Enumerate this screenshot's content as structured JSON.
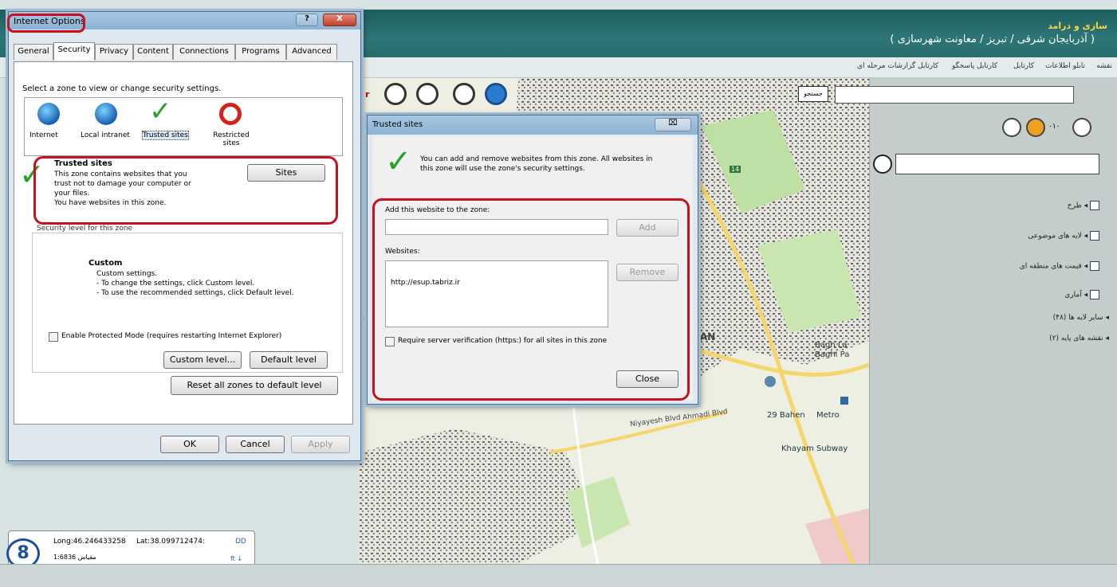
{
  "app": {
    "title": "سازی و درامد",
    "subtitle": "( آذربایجان شرقی / تبریز / معاونت شهرسازی )",
    "tabs": [
      "نقشه",
      "تابلو اطلاعات",
      "کارتابل",
      "کارتابل پاسخگو",
      "کارتابل گزارشات مرحله ای"
    ],
    "search_button": "جستجو",
    "map_labels": [
      "Bagh La",
      "Baghi Pa",
      "29 Bahen",
      "Metro",
      "Khayam Subway",
      "Niyayesh Blvd",
      "Ahmadi Blvd",
      "AN",
      "14"
    ],
    "coords": {
      "long": "Long:46.246433258",
      "lat": "Lat:38.099712474:",
      "dd": "DD",
      "scale": "مقیاس 1:6836",
      "scale_unit": "ft ↓"
    },
    "logo_text": "8"
  },
  "sidebar": {
    "layers": [
      "طرح",
      "لایه های موضوعی",
      "قیمت های منطقه ای",
      "آماری"
    ],
    "groups": [
      "سایر لایه ها (۴۸)",
      "نقشه های پایه (۲)"
    ],
    "zoom_value": "۰۱۰"
  },
  "internet_options": {
    "title": "Internet Options",
    "title_buttons": {
      "help": "?",
      "close": "X"
    },
    "tabs": [
      "General",
      "Security",
      "Privacy",
      "Content",
      "Connections",
      "Programs",
      "Advanced"
    ],
    "active_tab": "Security",
    "zone_prompt": "Select a zone to view or change security settings.",
    "zones": [
      "Internet",
      "Local intranet",
      "Trusted sites",
      "Restricted sites"
    ],
    "zone_title": "Trusted sites",
    "zone_desc_lines": [
      "This zone contains websites that you",
      "trust not to damage your computer or",
      "your files.",
      "You have websites in this zone."
    ],
    "sites_button": "Sites",
    "security_level_label": "Security level for this zone",
    "custom_title": "Custom",
    "custom_lines": [
      "Custom settings.",
      "- To change the settings, click Custom level.",
      "- To use the recommended settings, click Default level."
    ],
    "protected_mode": "Enable Protected Mode (requires restarting Internet Explorer)",
    "custom_level_button": "Custom level...",
    "default_level_button": "Default level",
    "reset_button": "Reset all zones to default level",
    "ok": "OK",
    "cancel": "Cancel",
    "apply": "Apply"
  },
  "trusted_sites": {
    "title": "Trusted sites",
    "close_x": "⌧",
    "intro_lines": [
      "You can add and remove websites from this zone. All websites in",
      "this zone will use the zone's security settings."
    ],
    "add_label": "Add this website to the zone:",
    "add_value": "",
    "add_button": "Add",
    "websites_label": "Websites:",
    "websites": [
      "http://esup.tabriz.ir"
    ],
    "remove_button": "Remove",
    "require_https": "Require server verification (https:) for all sites in this zone",
    "close_button": "Close"
  },
  "colors": {
    "header": "#2e7676",
    "title": "#f6d44a",
    "highlight": "#c8101f"
  }
}
